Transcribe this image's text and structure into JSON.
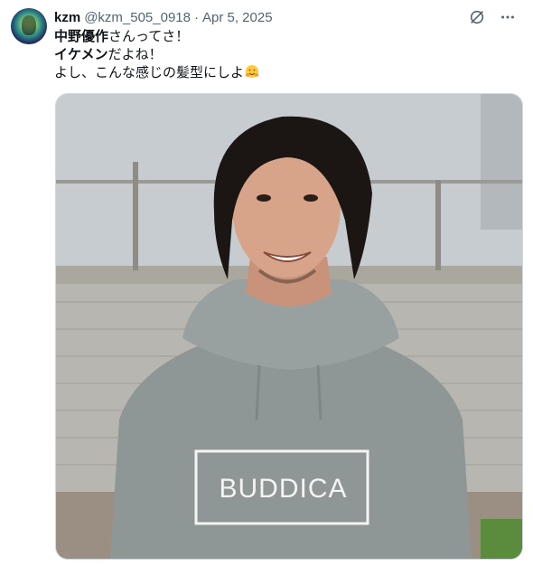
{
  "tweet": {
    "author_name": "kzm",
    "handle": "@kzm_505_0918",
    "separator": "·",
    "date": "Apr 5, 2025",
    "text_lines": [
      {
        "bold": "中野優作",
        "rest": "さんってさ！"
      },
      {
        "bold": "イケメン",
        "rest": "だよね！"
      },
      {
        "bold": "",
        "rest": "よし、こんな感じの髪型にしよ"
      }
    ],
    "emoji": "hugging-face-emoji",
    "icons": {
      "grok": "grok-icon",
      "more": "more-icon"
    }
  },
  "photo": {
    "hoodie_print": "BUDDICA",
    "colors": {
      "sky": "#c9ced3",
      "fence": "#a8a39a",
      "hoodie": "#8f9897",
      "skin": "#d7a48a",
      "hair": "#1b1613",
      "grass": "#4f8a3a"
    }
  }
}
